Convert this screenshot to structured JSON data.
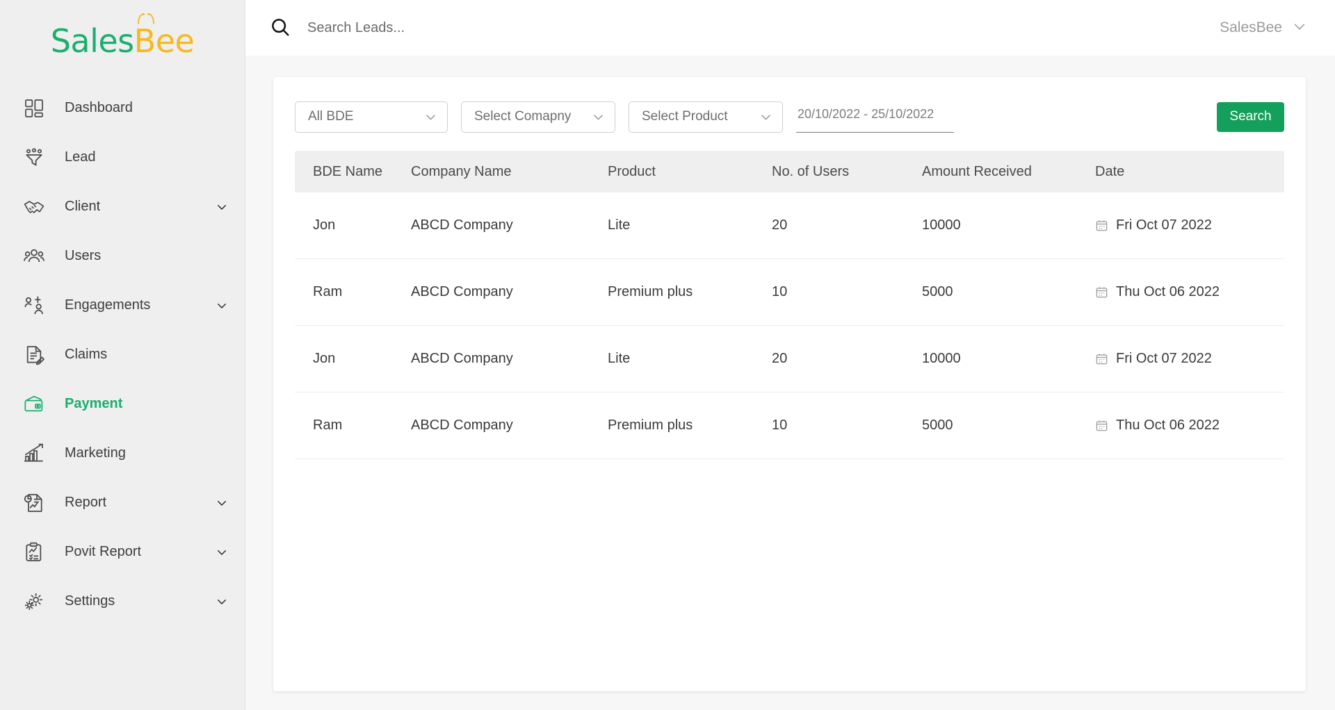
{
  "brand": {
    "name_part1": "Sales",
    "name_part2": "B",
    "name_part3": "ee",
    "green": "#1aaf6e",
    "yellow": "#f5b921"
  },
  "sidebar": {
    "items": [
      {
        "label": "Dashboard",
        "icon": "dashboard-icon",
        "expandable": false,
        "active": false
      },
      {
        "label": "Lead",
        "icon": "funnel-icon",
        "expandable": false,
        "active": false
      },
      {
        "label": "Client",
        "icon": "handshake-icon",
        "expandable": true,
        "active": false
      },
      {
        "label": "Users",
        "icon": "users-icon",
        "expandable": false,
        "active": false
      },
      {
        "label": "Engagements",
        "icon": "engagement-icon",
        "expandable": true,
        "active": false
      },
      {
        "label": "Claims",
        "icon": "claims-icon",
        "expandable": false,
        "active": false
      },
      {
        "label": "Payment",
        "icon": "wallet-icon",
        "expandable": false,
        "active": true
      },
      {
        "label": "Marketing",
        "icon": "chart-up-icon",
        "expandable": false,
        "active": false
      },
      {
        "label": "Report",
        "icon": "report-icon",
        "expandable": true,
        "active": false
      },
      {
        "label": "Povit Report",
        "icon": "clipboard-icon",
        "expandable": true,
        "active": false
      },
      {
        "label": "Settings",
        "icon": "gear-icon",
        "expandable": true,
        "active": false
      }
    ]
  },
  "topbar": {
    "search_placeholder": "Search Leads...",
    "search_value": "",
    "search_icon": "search-icon",
    "user_name": "SalesBee",
    "user_chevron": "chevron-down-icon"
  },
  "filters": {
    "bde": {
      "value": "All BDE",
      "chevron": "chevron-down-icon"
    },
    "company": {
      "value": "Select Comapny",
      "chevron": "chevron-down-icon"
    },
    "product": {
      "value": "Select Product",
      "chevron": "chevron-down-icon"
    },
    "date_range": {
      "value": "20/10/2022 - 25/10/2022",
      "placeholder": "20/10/2022 - 25/10/2022"
    },
    "search_button": "Search",
    "search_button_color": "#14a05c"
  },
  "table": {
    "columns": [
      "BDE Name",
      "Company Name",
      "Product",
      "No. of Users",
      "Amount Received",
      "Date"
    ],
    "date_icon": "calendar-icon",
    "rows": [
      {
        "bde": "Jon",
        "company": "ABCD Company",
        "product": "Lite",
        "users": "20",
        "amount": "10000",
        "date": "Fri Oct 07 2022"
      },
      {
        "bde": "Ram",
        "company": "ABCD Company",
        "product": "Premium plus",
        "users": "10",
        "amount": "5000",
        "date": "Thu Oct 06 2022"
      },
      {
        "bde": "Jon",
        "company": "ABCD Company",
        "product": "Lite",
        "users": "20",
        "amount": "10000",
        "date": "Fri Oct 07 2022"
      },
      {
        "bde": "Ram",
        "company": "ABCD Company",
        "product": "Premium plus",
        "users": "10",
        "amount": "5000",
        "date": "Thu Oct 06 2022"
      }
    ]
  }
}
